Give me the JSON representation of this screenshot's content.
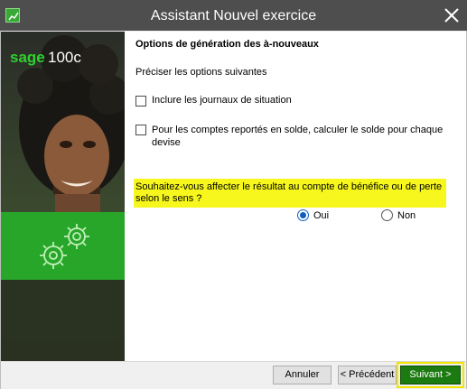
{
  "window": {
    "title": "Assistant Nouvel exercice",
    "icon": "chart-icon",
    "close_icon": "close-icon"
  },
  "sidebar": {
    "brand_logo": "sage 100c",
    "decor_icon": "gears-icon"
  },
  "content": {
    "heading": "Options de génération des à-nouveaux",
    "subtitle": "Préciser les options suivantes",
    "options": [
      {
        "label": "Inclure les journaux de situation",
        "checked": false
      },
      {
        "label": "Pour les comptes reportés en solde, calculer le solde pour chaque devise",
        "checked": false
      }
    ],
    "question": "Souhaitez-vous affecter le résultat au compte de bénéfice ou de perte selon le sens ?",
    "radio_oui": {
      "label": "Oui",
      "selected": true
    },
    "radio_non": {
      "label": "Non",
      "selected": false
    }
  },
  "footer": {
    "cancel_label": "Annuler",
    "previous_label": "< Précédent",
    "next_label": "Suivant >"
  },
  "colors": {
    "titlebar": "#4e4e4e",
    "highlight_yellow": "#f7f71e",
    "brand_green": "#1b7a10",
    "radio_blue": "#0f5fbf"
  }
}
